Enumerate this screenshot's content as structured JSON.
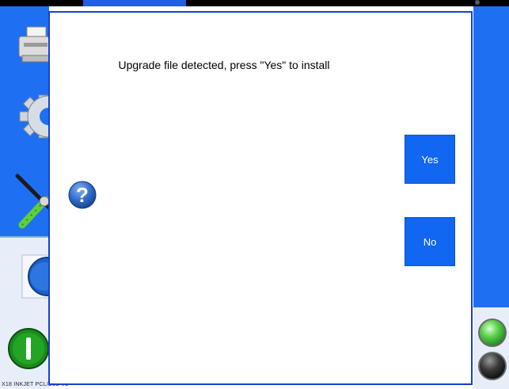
{
  "dialog": {
    "message": "Upgrade file detected, press \"Yes\" to install",
    "yes_label": "Yes",
    "no_label": "No"
  },
  "footer": {
    "text": "X18 INKJET PCL/D3S V1"
  },
  "sidebar": {
    "items": [
      {
        "icon": "printer-icon"
      },
      {
        "icon": "gear-icon"
      },
      {
        "icon": "tools-icon"
      },
      {
        "icon": "info-icon"
      },
      {
        "icon": "power-icon"
      }
    ]
  },
  "status_lights": [
    {
      "name": "status-light-green",
      "color": "#38c038"
    },
    {
      "name": "status-light-off",
      "color": "#2c2c2c"
    }
  ],
  "colors": {
    "accent": "#1f6ff2",
    "button": "#1166f2",
    "dialog_border": "#1a3fd2"
  }
}
